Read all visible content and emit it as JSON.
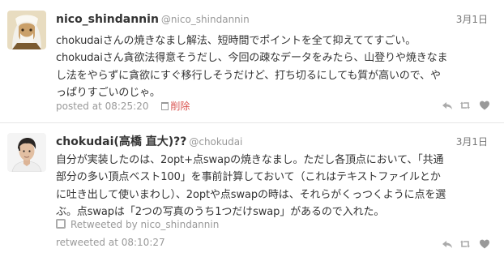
{
  "tweets": [
    {
      "fullname": "nico_shindannin",
      "screenname": "@nico_shindannin",
      "date": "3月1日",
      "lines": [
        "chokudaiさんの焼きなまし解法、短時間でポイントを全て抑えててすごい。",
        "chokudaiさん貪欲法得意そうだし、今回の疎なデータをみたら、山登りや焼きなま",
        "し法をやらずに貪欲にすぐ移行しそうだけど、打ち切るにしても質が高いので、や",
        "っぱりすごいのじゃ。"
      ],
      "posted": "posted at 08:25:20",
      "delete_label": "削除",
      "avatar_colors": {
        "bg": "#e8dcc0",
        "hair": "#f2f0ea",
        "face": "#caa06a",
        "shadow": "#7a5a30"
      }
    },
    {
      "fullname": "chokudai(高橋 直大)??",
      "screenname": "@chokudai",
      "date": "3月1日",
      "lines": [
        "自分が実装したのは、2opt+点swapの焼きなまし。ただし各頂点において、「共通",
        "部分の多い頂点ベスト100」を事前計算しておいて（これはテキストファイルとか",
        "に吐き出して使いまわし）、2optや点swapの時は、それらがくっつくように点を選",
        "ぶ。点swapは「2つの写真のうち1つだけswap」があるので入れた。"
      ],
      "retweeted_by": "Retweeted by nico_shindannin",
      "posted": "retweeted at 08:10:27",
      "avatar_colors": {
        "bg": "#f4f4f4",
        "hair": "#2a2624",
        "face": "#e2bfa2",
        "shirt": "#eeeeee"
      }
    }
  ],
  "colors": {
    "text": "#333333",
    "muted": "#999999",
    "delete": "#d9534f",
    "divider": "#e6e6e6"
  },
  "icons": [
    "reply-icon",
    "retweet-icon",
    "favorite-icon",
    "trash-icon"
  ]
}
